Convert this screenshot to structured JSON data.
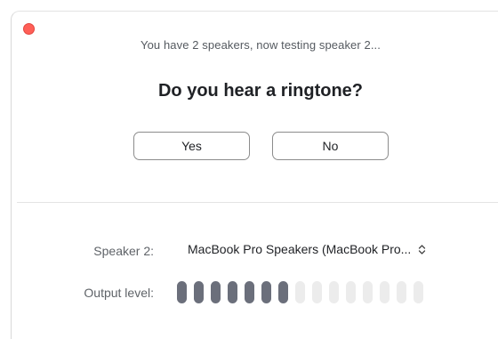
{
  "window": {
    "status_text": "You have 2 speakers, now testing speaker 2...",
    "question": "Do you hear a ringtone?"
  },
  "buttons": {
    "yes_label": "Yes",
    "no_label": "No"
  },
  "speaker": {
    "label": "Speaker 2:",
    "selected_value": "MacBook Pro Speakers (MacBook Pro..."
  },
  "output": {
    "label": "Output level:",
    "active_segments": 7,
    "total_segments": 15
  },
  "colors": {
    "close_button": "#ff5f57",
    "level_active": "#6b6f7b",
    "level_inactive": "#ececec"
  },
  "icons": {
    "close": "close-dot-icon",
    "select": "chevron-updown-icon"
  }
}
